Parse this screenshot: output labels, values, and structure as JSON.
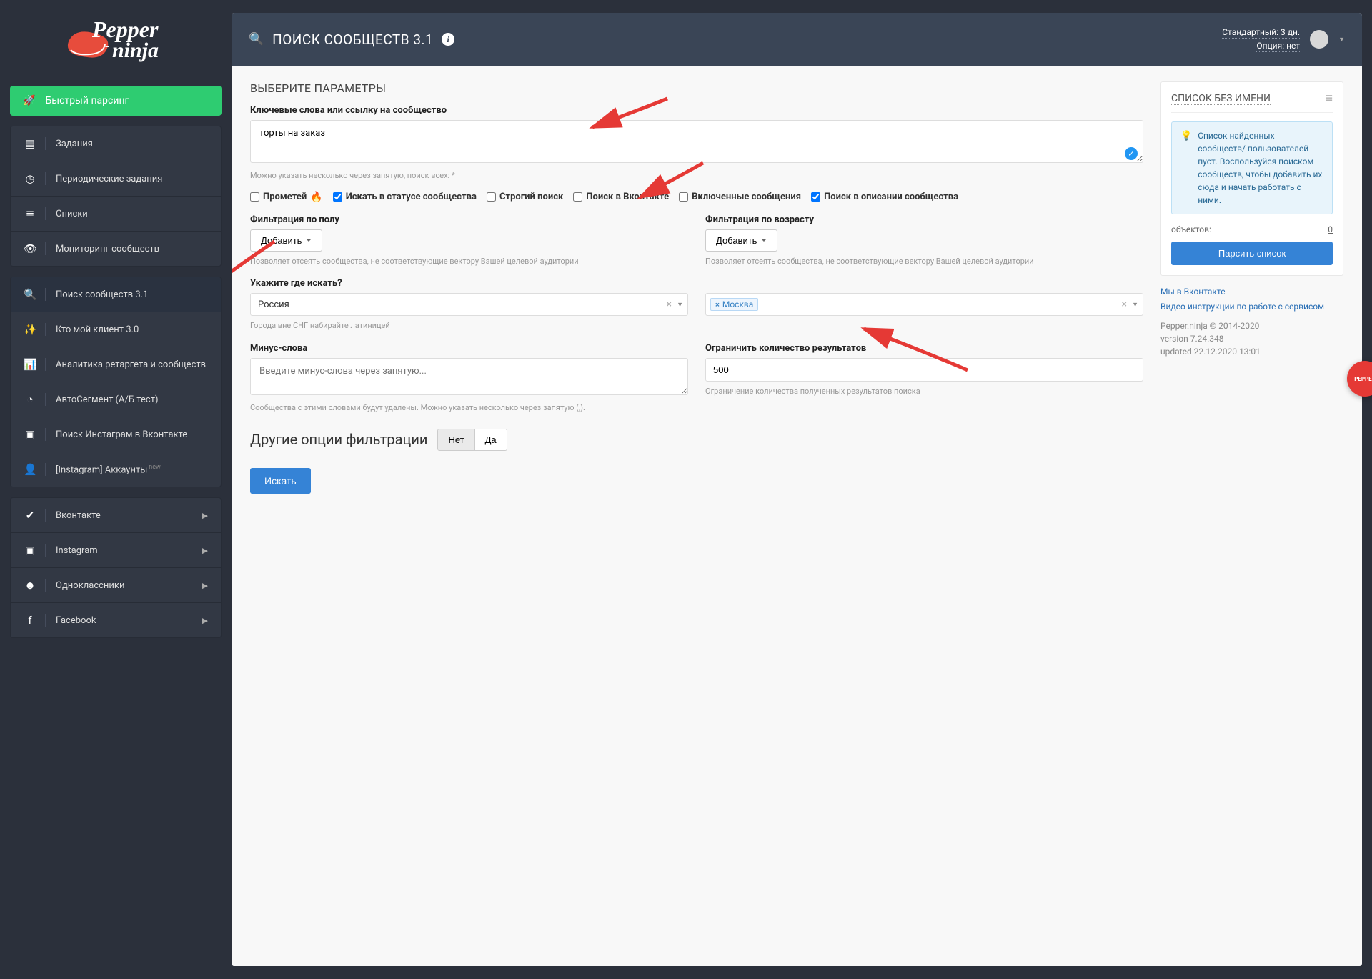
{
  "sidebar": {
    "fast_parse": "Быстрый парсинг",
    "block1": [
      {
        "icon": "tasks",
        "label": "Задания"
      },
      {
        "icon": "clock",
        "label": "Периодические задания"
      },
      {
        "icon": "list",
        "label": "Списки"
      },
      {
        "icon": "binoc",
        "label": "Мониторинг сообществ"
      }
    ],
    "block2": [
      {
        "icon": "search",
        "label": "Поиск сообществ 3.1",
        "active": true
      },
      {
        "icon": "wand",
        "label": "Кто мой клиент 3.0"
      },
      {
        "icon": "chart",
        "label": "Аналитика ретаргета и сообществ"
      },
      {
        "icon": "pie",
        "label": "АвтоСегмент (А/Б тест)"
      },
      {
        "icon": "insta",
        "label": "Поиск Инстаграм в Вконтакте"
      },
      {
        "icon": "user",
        "label": "[Instagram] Аккаунты",
        "sup": "new"
      }
    ],
    "block3": [
      {
        "icon": "vk",
        "label": "Вконтакте",
        "expand": true
      },
      {
        "icon": "insta",
        "label": "Instagram",
        "expand": true
      },
      {
        "icon": "ok",
        "label": "Одноклассники",
        "expand": true
      },
      {
        "icon": "fb",
        "label": "Facebook",
        "expand": true
      }
    ]
  },
  "topbar": {
    "title": "ПОИСК СООБЩЕСТВ 3.1",
    "tariff": "Стандартный: 3 дн.",
    "option": "Опция: нет"
  },
  "form": {
    "section": "ВЫБЕРИТЕ ПАРАМЕТРЫ",
    "kw_label": "Ключевые слова или ссылку на сообщество",
    "kw_value": "торты на заказ",
    "kw_hint": "Можно указать несколько через запятую, поиск всех: *",
    "ck_promethey": "Прометей",
    "ck_status": "Искать в статусе сообщества",
    "ck_strict": "Строгий поиск",
    "ck_vk": "Поиск в Вконтакте",
    "ck_enabled": "Включенные сообщения",
    "ck_desc": "Поиск в описании сообщества",
    "gender_label": "Фильтрация по полу",
    "age_label": "Фильтрация по возрасту",
    "add_btn": "Добавить",
    "filter_hint": "Позволяет отсеять сообщества, не соответствующие вектору Вашей целевой аудитории",
    "where_label": "Укажите где искать?",
    "country": "Россия",
    "city": "Москва",
    "where_hint": "Города вне СНГ набирайте латиницей",
    "minus_label": "Минус-слова",
    "minus_ph": "Введите минус-слова через запятую...",
    "minus_hint": "Сообщества с этими словами будут удалены. Можно указать несколько через запятую (,).",
    "limit_label": "Ограничить количество результатов",
    "limit_value": "500",
    "limit_hint": "Ограничение количества полученных результатов поиска",
    "other_opts": "Другие опции фильтрации",
    "no": "Нет",
    "yes": "Да",
    "search_btn": "Искать"
  },
  "panel": {
    "title": "СПИСОК БЕЗ ИМЕНИ",
    "info": "Список найденных сообществ/ пользователей пуст. Воспользуйся поиском сообществ, чтобы добавить их сюда и начать работать с ними.",
    "objects": "объектов:",
    "objects_val": "0",
    "parse_btn": "Парсить список"
  },
  "links": {
    "vk": "Мы в Вконтакте",
    "video": "Видео инструкции по работе с сервисом"
  },
  "meta": {
    "copy": "Pepper.ninja © 2014-2020",
    "ver": "version 7.24.348",
    "upd": "updated 22.12.2020 13:01"
  }
}
